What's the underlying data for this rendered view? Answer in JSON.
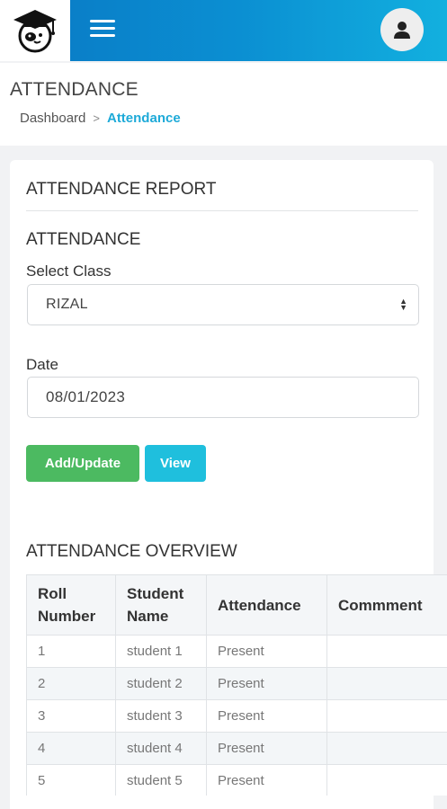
{
  "header": {
    "logo_icon": "graduation-cap-mascot-icon",
    "menu_icon": "hamburger-menu-icon",
    "avatar_icon": "user-icon",
    "bar_color_start": "#0a7fc8",
    "bar_color_end": "#12b0df"
  },
  "page": {
    "title": "ATTENDANCE",
    "breadcrumb": {
      "home": "Dashboard",
      "separator": ">",
      "current": "Attendance"
    }
  },
  "card": {
    "title": "ATTENDANCE REPORT",
    "section_title": "ATTENDANCE",
    "class_label": "Select Class",
    "class_value": "RIZAL",
    "date_label": "Date",
    "date_value": "08/01/2023",
    "add_update_label": "Add/Update",
    "view_label": "View",
    "add_update_color": "#4cba61",
    "view_color": "#1fbfdd"
  },
  "overview": {
    "title": "ATTENDANCE OVERVIEW",
    "columns": [
      "Roll Number",
      "Student Name",
      "Attendance",
      "Commment"
    ],
    "rows": [
      {
        "roll": "1",
        "name": "student 1",
        "attendance": "Present",
        "comment": ""
      },
      {
        "roll": "2",
        "name": "student 2",
        "attendance": "Present",
        "comment": ""
      },
      {
        "roll": "3",
        "name": "student 3",
        "attendance": "Present",
        "comment": ""
      },
      {
        "roll": "4",
        "name": "student 4",
        "attendance": "Present",
        "comment": ""
      },
      {
        "roll": "5",
        "name": "student 5",
        "attendance": "Present",
        "comment": ""
      }
    ]
  }
}
